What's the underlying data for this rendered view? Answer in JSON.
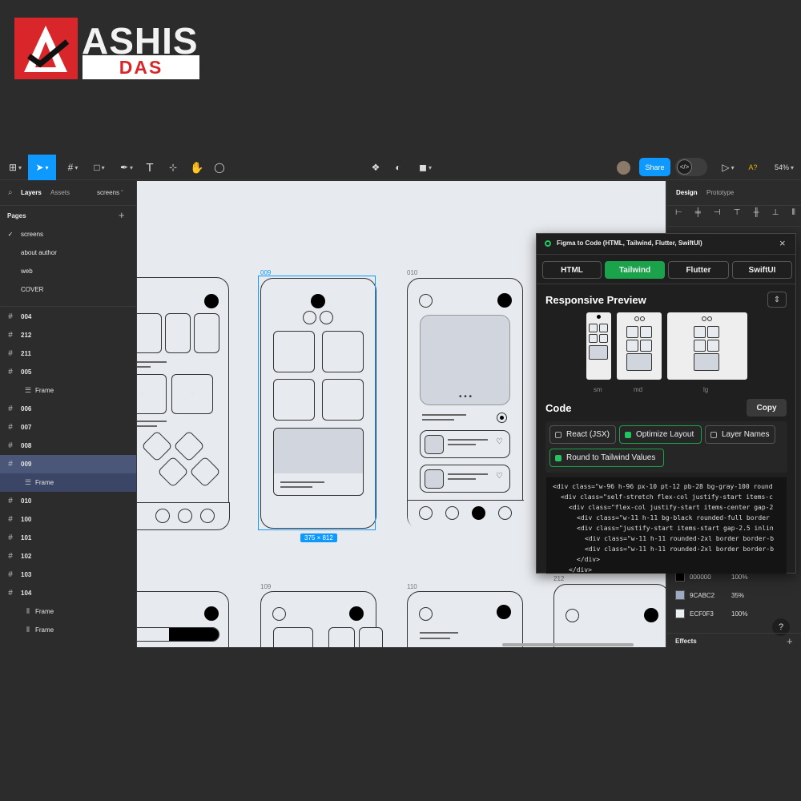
{
  "branding": {
    "line1": "ASHIS",
    "line2": "DAS"
  },
  "toolbar": {
    "share_label": "Share",
    "zoom_label": "54%",
    "missing_fonts": "A?",
    "dev_mode_icon": "code-icon"
  },
  "left_panel": {
    "tabs": [
      "Layers",
      "Assets"
    ],
    "page_selector": "screens",
    "pages_header": "Pages",
    "pages": [
      "screens",
      "about author",
      "web",
      "COVER"
    ],
    "layers": [
      {
        "label": "004",
        "type": "frame"
      },
      {
        "label": "212",
        "type": "frame"
      },
      {
        "label": "211",
        "type": "frame"
      },
      {
        "label": "005",
        "type": "frame"
      },
      {
        "label": "Frame",
        "type": "child"
      },
      {
        "label": "006",
        "type": "frame"
      },
      {
        "label": "007",
        "type": "frame"
      },
      {
        "label": "008",
        "type": "frame"
      },
      {
        "label": "009",
        "type": "frame",
        "selected": true
      },
      {
        "label": "Frame",
        "type": "child",
        "selected": true
      },
      {
        "label": "010",
        "type": "frame"
      },
      {
        "label": "100",
        "type": "frame"
      },
      {
        "label": "101",
        "type": "frame"
      },
      {
        "label": "102",
        "type": "frame"
      },
      {
        "label": "103",
        "type": "frame"
      },
      {
        "label": "104",
        "type": "frame"
      },
      {
        "label": "Frame",
        "type": "child"
      },
      {
        "label": "Frame",
        "type": "child"
      }
    ]
  },
  "canvas": {
    "frames": {
      "f009": "009",
      "f010": "010",
      "f109": "109",
      "f110": "110",
      "f212": "212"
    },
    "size_badge": "375 × 812"
  },
  "right_panel": {
    "tabs": [
      "Design",
      "Prototype"
    ],
    "colors": [
      {
        "hex": "000000",
        "opacity": "100%",
        "color": "#000000"
      },
      {
        "hex": "9CABC2",
        "opacity": "35%",
        "color": "#9CABC2"
      },
      {
        "hex": "ECF0F3",
        "opacity": "100%",
        "color": "#ECF0F3"
      }
    ],
    "effects_label": "Effects",
    "help_label": "?"
  },
  "plugin": {
    "title": "Figma to Code (HTML, Tailwind, Flutter, SwiftUI)",
    "tabs": [
      "HTML",
      "Tailwind",
      "Flutter",
      "SwiftUI"
    ],
    "active_tab": "Tailwind",
    "responsive_title": "Responsive Preview",
    "preview_labels": [
      "sm",
      "md",
      "lg"
    ],
    "code_title": "Code",
    "copy_label": "Copy",
    "options": [
      {
        "label": "React (JSX)",
        "checked": false
      },
      {
        "label": "Optimize Layout",
        "checked": true
      },
      {
        "label": "Layer Names",
        "checked": false
      },
      {
        "label": "Round to Tailwind Values",
        "checked": true
      }
    ],
    "code_lines": [
      {
        "indent": 0,
        "text": "<div class=\"w-96 h-96 px-10 pt-12 pb-28 bg-gray-100 round"
      },
      {
        "indent": 1,
        "text": "<div class=\"self-stretch flex-col justify-start items-c"
      },
      {
        "indent": 2,
        "text": "<div class=\"flex-col justify-start items-center gap-2"
      },
      {
        "indent": 3,
        "text": "<div class=\"w-11 h-11 bg-black rounded-full border"
      },
      {
        "indent": 3,
        "text": "<div class=\"justify-start items-start gap-2.5 inlin"
      },
      {
        "indent": 4,
        "text": "<div class=\"w-11 h-11 rounded-2xl border border-b"
      },
      {
        "indent": 4,
        "text": "<div class=\"w-11 h-11 rounded-2xl border border-b"
      },
      {
        "indent": 3,
        "text": "</div>"
      },
      {
        "indent": 2,
        "text": "</div>"
      }
    ]
  }
}
